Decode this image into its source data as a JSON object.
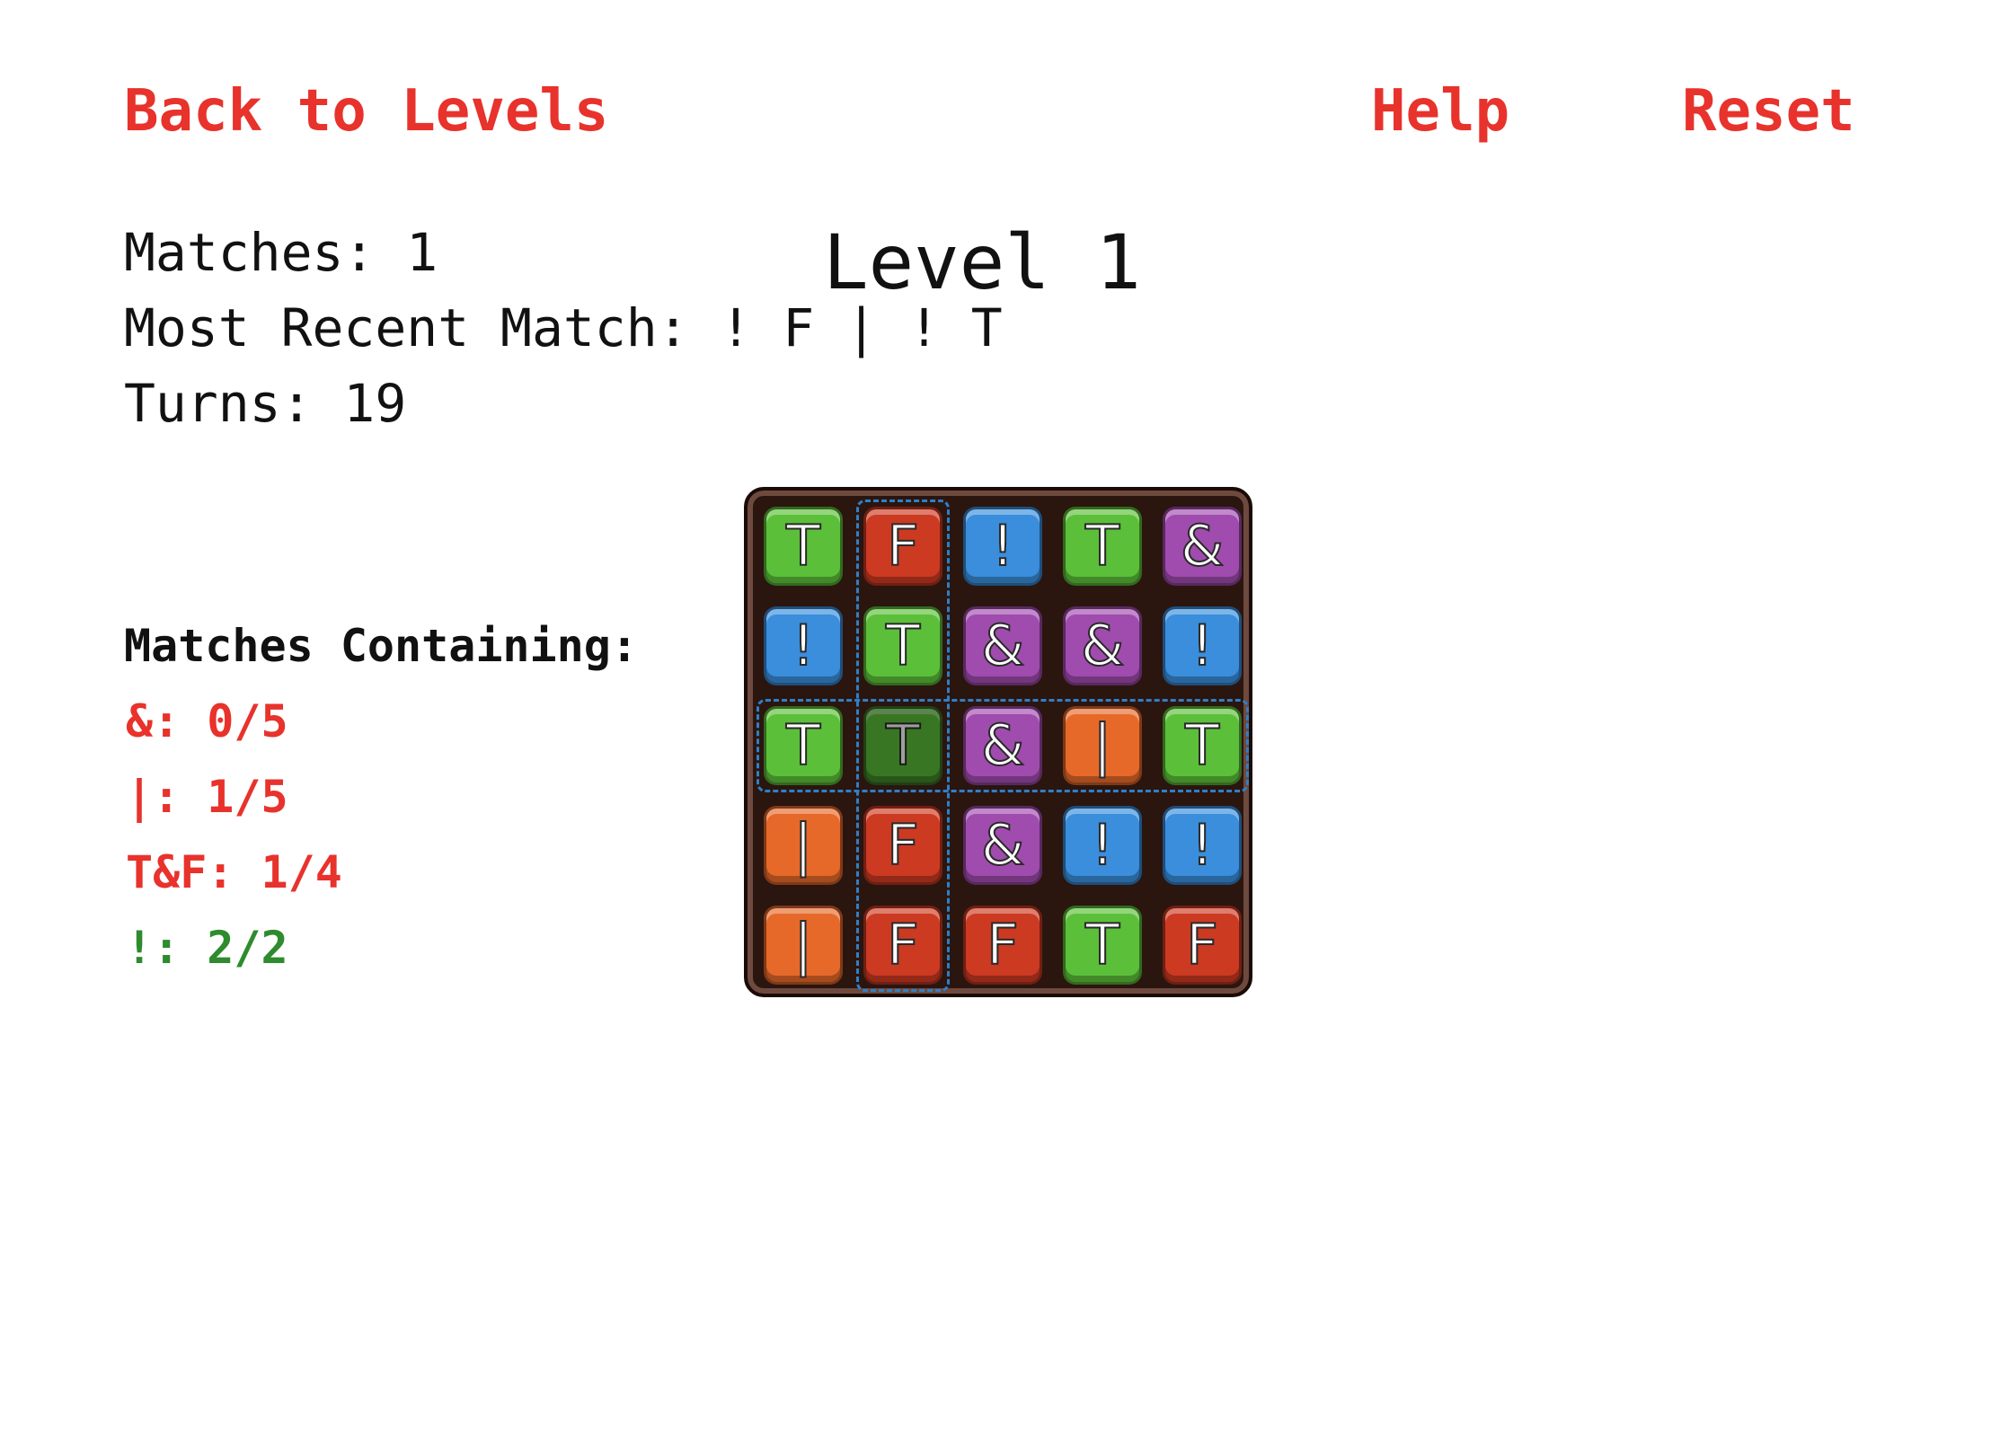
{
  "nav": {
    "back_label": "Back to Levels",
    "help_label": "Help",
    "reset_label": "Reset"
  },
  "stats": {
    "matches": "Matches: 1",
    "recent": "Most Recent Match: ! F | ! T",
    "turns": "Turns: 19"
  },
  "level_title": "Level 1",
  "goals": {
    "heading": "Matches Containing:",
    "items": [
      {
        "label": "&: 0/5",
        "color": "#e8322c"
      },
      {
        "label": "|: 1/5",
        "color": "#e8322c"
      },
      {
        "label": "T&F: 1/4",
        "color": "#e8322c"
      },
      {
        "label": "!: 2/2",
        "color": "#2e8b2e"
      }
    ]
  },
  "tile_colors": {
    "T": "#5cbf3a",
    "F": "#cc3a22",
    "!": "#3a8edc",
    "&": "#a04cae",
    "|": "#e6692a"
  },
  "board": {
    "rows": [
      [
        "T",
        "F",
        "!",
        "T",
        "&"
      ],
      [
        "!",
        "T",
        "&",
        "&",
        "!"
      ],
      [
        "T",
        "T",
        "&",
        "|",
        "T"
      ],
      [
        "|",
        "F",
        "&",
        "!",
        "!"
      ],
      [
        "|",
        "F",
        "F",
        "T",
        "F"
      ]
    ],
    "selected": [
      [
        2,
        1
      ]
    ],
    "highlight_row": 2,
    "highlight_col": 1
  }
}
